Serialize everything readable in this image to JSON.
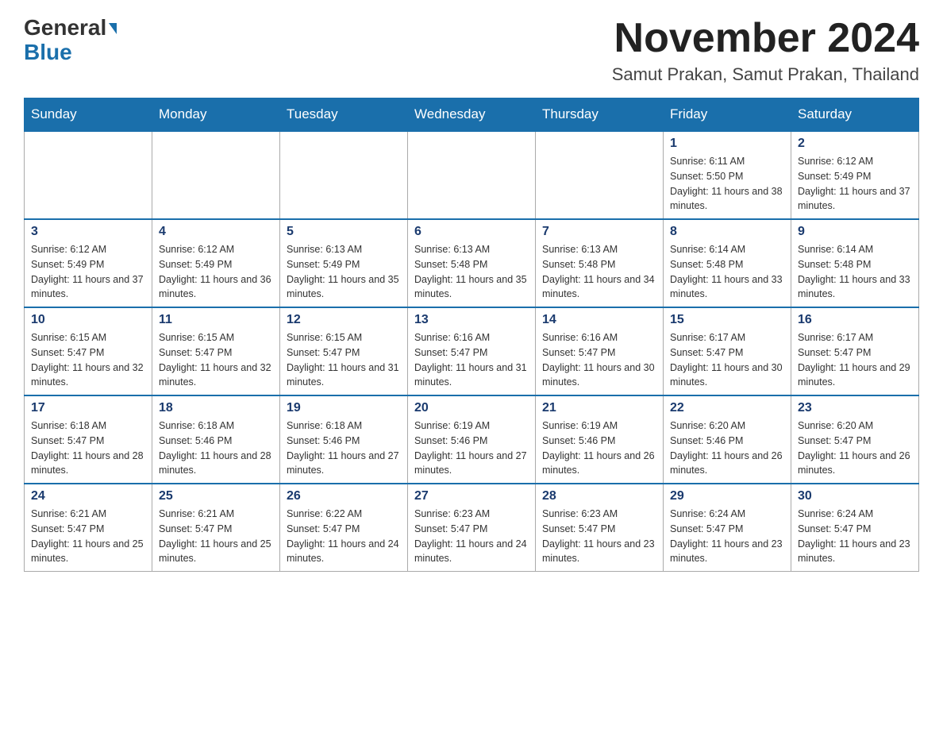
{
  "header": {
    "logo_general": "General",
    "logo_blue": "Blue",
    "month_title": "November 2024",
    "location": "Samut Prakan, Samut Prakan, Thailand"
  },
  "days_of_week": [
    "Sunday",
    "Monday",
    "Tuesday",
    "Wednesday",
    "Thursday",
    "Friday",
    "Saturday"
  ],
  "weeks": [
    {
      "days": [
        {
          "num": "",
          "sunrise": "",
          "sunset": "",
          "daylight": ""
        },
        {
          "num": "",
          "sunrise": "",
          "sunset": "",
          "daylight": ""
        },
        {
          "num": "",
          "sunrise": "",
          "sunset": "",
          "daylight": ""
        },
        {
          "num": "",
          "sunrise": "",
          "sunset": "",
          "daylight": ""
        },
        {
          "num": "",
          "sunrise": "",
          "sunset": "",
          "daylight": ""
        },
        {
          "num": "1",
          "sunrise": "Sunrise: 6:11 AM",
          "sunset": "Sunset: 5:50 PM",
          "daylight": "Daylight: 11 hours and 38 minutes."
        },
        {
          "num": "2",
          "sunrise": "Sunrise: 6:12 AM",
          "sunset": "Sunset: 5:49 PM",
          "daylight": "Daylight: 11 hours and 37 minutes."
        }
      ]
    },
    {
      "days": [
        {
          "num": "3",
          "sunrise": "Sunrise: 6:12 AM",
          "sunset": "Sunset: 5:49 PM",
          "daylight": "Daylight: 11 hours and 37 minutes."
        },
        {
          "num": "4",
          "sunrise": "Sunrise: 6:12 AM",
          "sunset": "Sunset: 5:49 PM",
          "daylight": "Daylight: 11 hours and 36 minutes."
        },
        {
          "num": "5",
          "sunrise": "Sunrise: 6:13 AM",
          "sunset": "Sunset: 5:49 PM",
          "daylight": "Daylight: 11 hours and 35 minutes."
        },
        {
          "num": "6",
          "sunrise": "Sunrise: 6:13 AM",
          "sunset": "Sunset: 5:48 PM",
          "daylight": "Daylight: 11 hours and 35 minutes."
        },
        {
          "num": "7",
          "sunrise": "Sunrise: 6:13 AM",
          "sunset": "Sunset: 5:48 PM",
          "daylight": "Daylight: 11 hours and 34 minutes."
        },
        {
          "num": "8",
          "sunrise": "Sunrise: 6:14 AM",
          "sunset": "Sunset: 5:48 PM",
          "daylight": "Daylight: 11 hours and 33 minutes."
        },
        {
          "num": "9",
          "sunrise": "Sunrise: 6:14 AM",
          "sunset": "Sunset: 5:48 PM",
          "daylight": "Daylight: 11 hours and 33 minutes."
        }
      ]
    },
    {
      "days": [
        {
          "num": "10",
          "sunrise": "Sunrise: 6:15 AM",
          "sunset": "Sunset: 5:47 PM",
          "daylight": "Daylight: 11 hours and 32 minutes."
        },
        {
          "num": "11",
          "sunrise": "Sunrise: 6:15 AM",
          "sunset": "Sunset: 5:47 PM",
          "daylight": "Daylight: 11 hours and 32 minutes."
        },
        {
          "num": "12",
          "sunrise": "Sunrise: 6:15 AM",
          "sunset": "Sunset: 5:47 PM",
          "daylight": "Daylight: 11 hours and 31 minutes."
        },
        {
          "num": "13",
          "sunrise": "Sunrise: 6:16 AM",
          "sunset": "Sunset: 5:47 PM",
          "daylight": "Daylight: 11 hours and 31 minutes."
        },
        {
          "num": "14",
          "sunrise": "Sunrise: 6:16 AM",
          "sunset": "Sunset: 5:47 PM",
          "daylight": "Daylight: 11 hours and 30 minutes."
        },
        {
          "num": "15",
          "sunrise": "Sunrise: 6:17 AM",
          "sunset": "Sunset: 5:47 PM",
          "daylight": "Daylight: 11 hours and 30 minutes."
        },
        {
          "num": "16",
          "sunrise": "Sunrise: 6:17 AM",
          "sunset": "Sunset: 5:47 PM",
          "daylight": "Daylight: 11 hours and 29 minutes."
        }
      ]
    },
    {
      "days": [
        {
          "num": "17",
          "sunrise": "Sunrise: 6:18 AM",
          "sunset": "Sunset: 5:47 PM",
          "daylight": "Daylight: 11 hours and 28 minutes."
        },
        {
          "num": "18",
          "sunrise": "Sunrise: 6:18 AM",
          "sunset": "Sunset: 5:46 PM",
          "daylight": "Daylight: 11 hours and 28 minutes."
        },
        {
          "num": "19",
          "sunrise": "Sunrise: 6:18 AM",
          "sunset": "Sunset: 5:46 PM",
          "daylight": "Daylight: 11 hours and 27 minutes."
        },
        {
          "num": "20",
          "sunrise": "Sunrise: 6:19 AM",
          "sunset": "Sunset: 5:46 PM",
          "daylight": "Daylight: 11 hours and 27 minutes."
        },
        {
          "num": "21",
          "sunrise": "Sunrise: 6:19 AM",
          "sunset": "Sunset: 5:46 PM",
          "daylight": "Daylight: 11 hours and 26 minutes."
        },
        {
          "num": "22",
          "sunrise": "Sunrise: 6:20 AM",
          "sunset": "Sunset: 5:46 PM",
          "daylight": "Daylight: 11 hours and 26 minutes."
        },
        {
          "num": "23",
          "sunrise": "Sunrise: 6:20 AM",
          "sunset": "Sunset: 5:47 PM",
          "daylight": "Daylight: 11 hours and 26 minutes."
        }
      ]
    },
    {
      "days": [
        {
          "num": "24",
          "sunrise": "Sunrise: 6:21 AM",
          "sunset": "Sunset: 5:47 PM",
          "daylight": "Daylight: 11 hours and 25 minutes."
        },
        {
          "num": "25",
          "sunrise": "Sunrise: 6:21 AM",
          "sunset": "Sunset: 5:47 PM",
          "daylight": "Daylight: 11 hours and 25 minutes."
        },
        {
          "num": "26",
          "sunrise": "Sunrise: 6:22 AM",
          "sunset": "Sunset: 5:47 PM",
          "daylight": "Daylight: 11 hours and 24 minutes."
        },
        {
          "num": "27",
          "sunrise": "Sunrise: 6:23 AM",
          "sunset": "Sunset: 5:47 PM",
          "daylight": "Daylight: 11 hours and 24 minutes."
        },
        {
          "num": "28",
          "sunrise": "Sunrise: 6:23 AM",
          "sunset": "Sunset: 5:47 PM",
          "daylight": "Daylight: 11 hours and 23 minutes."
        },
        {
          "num": "29",
          "sunrise": "Sunrise: 6:24 AM",
          "sunset": "Sunset: 5:47 PM",
          "daylight": "Daylight: 11 hours and 23 minutes."
        },
        {
          "num": "30",
          "sunrise": "Sunrise: 6:24 AM",
          "sunset": "Sunset: 5:47 PM",
          "daylight": "Daylight: 11 hours and 23 minutes."
        }
      ]
    }
  ]
}
